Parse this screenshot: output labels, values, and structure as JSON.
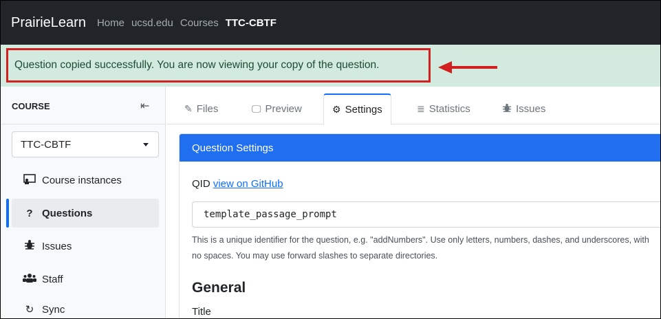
{
  "navbar": {
    "brand": "PrairieLearn",
    "links": [
      "Home",
      "ucsd.edu",
      "Courses",
      "TTC-CBTF"
    ]
  },
  "alert": {
    "message": "Question copied successfully. You are now viewing your copy of the question.",
    "highlight_color": "#d21f1f"
  },
  "sidebar": {
    "header": "COURSE",
    "course_select": "TTC-CBTF",
    "items": [
      {
        "label": "Course instances",
        "icon": "chalkboard-teacher-icon"
      },
      {
        "label": "Questions",
        "icon": "question-icon"
      },
      {
        "label": "Issues",
        "icon": "bug-icon"
      },
      {
        "label": "Staff",
        "icon": "users-icon"
      },
      {
        "label": "Sync",
        "icon": "sync-icon"
      }
    ]
  },
  "tabs": [
    {
      "label": "Files",
      "icon": "edit-icon"
    },
    {
      "label": "Preview",
      "icon": "monitor-icon"
    },
    {
      "label": "Settings",
      "icon": "gear-icon"
    },
    {
      "label": "Statistics",
      "icon": "chart-icon"
    },
    {
      "label": "Issues",
      "icon": "bug-icon"
    }
  ],
  "settings": {
    "card_title": "Question Settings",
    "qid_label": "QID",
    "qid_link": "view on GitHub",
    "qid_value": "template_passage_prompt",
    "help_text": "This is a unique identifier for the question, e.g. \"addNumbers\". Use only letters, numbers, dashes, and underscores, with no spaces. You may use forward slashes to separate directories.",
    "section_heading": "General",
    "title_label": "Title"
  },
  "colors": {
    "navbar": "#212529",
    "alert_bg": "#d3ebdf",
    "accent": "#1f6ff0"
  }
}
